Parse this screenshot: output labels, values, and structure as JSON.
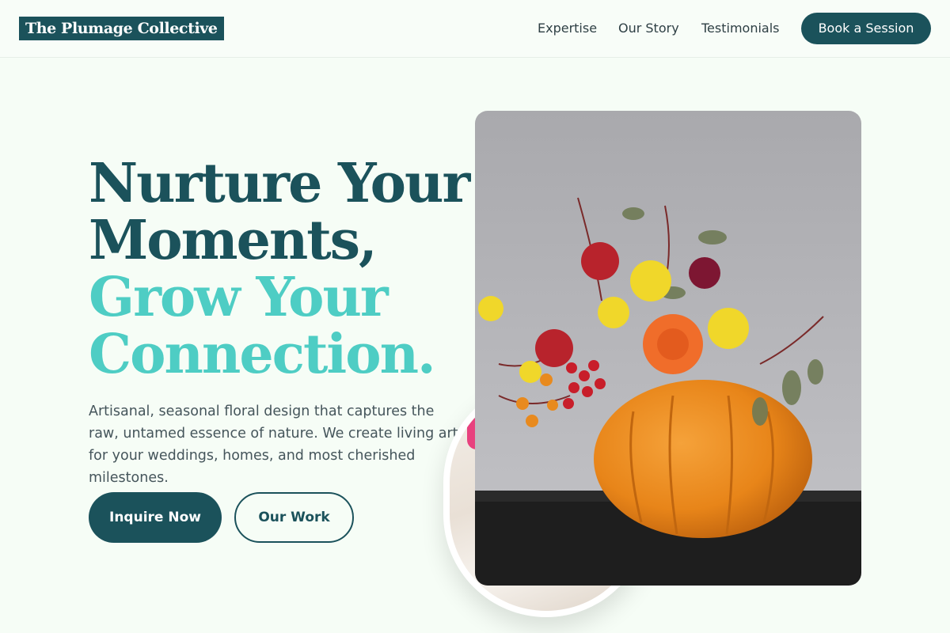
{
  "header": {
    "logo": "The Plumage Collective",
    "nav": [
      "Expertise",
      "Our Story",
      "Testimonials"
    ],
    "cta": "Book a Session"
  },
  "hero": {
    "headline_line1": "Nurture Your",
    "headline_line2": "Moments,",
    "headline_line3": "Grow Your",
    "headline_line4": "Connection.",
    "subtext": "Artisanal, seasonal floral design that captures the raw, untamed essence of nature. We create living art for your weddings, homes, and most cherished milestones.",
    "primary_button": "Inquire Now",
    "secondary_button": "Our Work"
  },
  "colors": {
    "brand_dark": "#1b525b",
    "brand_teal": "#4ecdc4",
    "background": "#f6fdf6"
  }
}
